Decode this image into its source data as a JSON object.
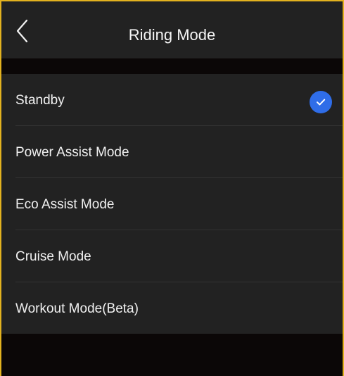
{
  "header": {
    "title": "Riding Mode",
    "back_icon": "chevron-left-icon"
  },
  "modes": [
    {
      "label": "Standby",
      "selected": true
    },
    {
      "label": "Power Assist Mode",
      "selected": false
    },
    {
      "label": "Eco Assist Mode",
      "selected": false
    },
    {
      "label": "Cruise Mode",
      "selected": false
    },
    {
      "label": "Workout Mode(Beta)",
      "selected": false
    }
  ],
  "colors": {
    "frame_border": "#e3b21f",
    "check_background": "#2f6de8",
    "panel_background": "#222222"
  }
}
